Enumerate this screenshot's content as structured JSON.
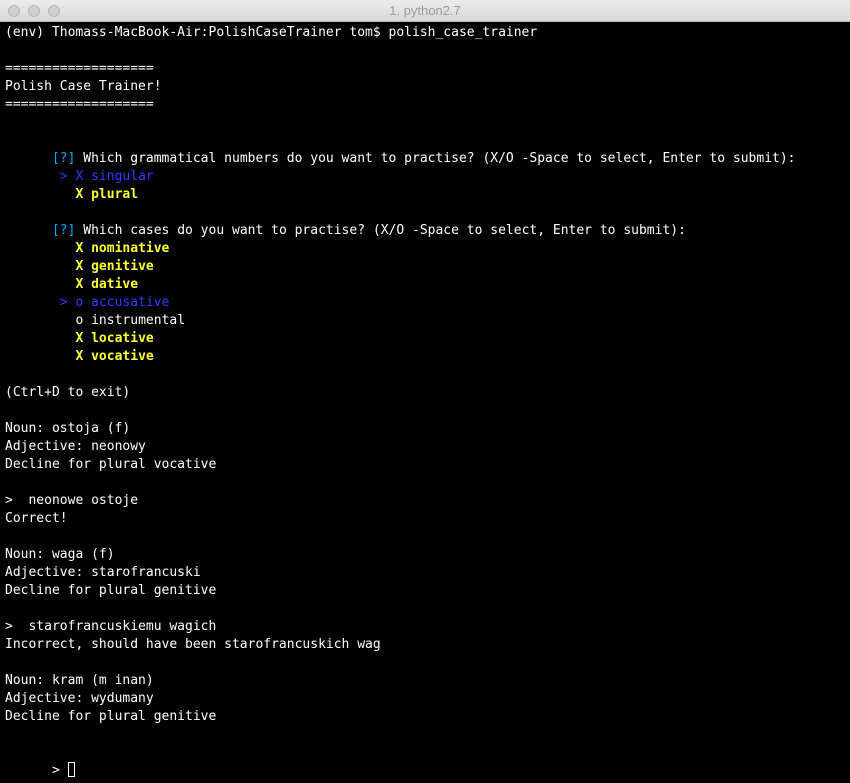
{
  "window": {
    "title": "1. python2.7"
  },
  "terminal": {
    "prompt_line": "(env) Thomass-MacBook-Air:PolishCaseTrainer tom$ polish_case_trainer",
    "banner_rule_top": "===================",
    "banner_title": "Polish Case Trainer!",
    "banner_rule_bottom": "===================",
    "q1": {
      "marker": "[?]",
      "text": " Which grammatical numbers do you want to practise? (X/O -Space to select, Enter to submit):",
      "options": [
        {
          "pointer": " > ",
          "check": "X",
          "label": "singular",
          "state": "cursor"
        },
        {
          "pointer": "   ",
          "check": "X",
          "label": "plural",
          "state": "selected"
        }
      ]
    },
    "q2": {
      "marker": "[?]",
      "text": " Which cases do you want to practise? (X/O -Space to select, Enter to submit):",
      "options": [
        {
          "pointer": "   ",
          "check": "X",
          "label": "nominative",
          "state": "selected"
        },
        {
          "pointer": "   ",
          "check": "X",
          "label": "genitive",
          "state": "selected"
        },
        {
          "pointer": "   ",
          "check": "X",
          "label": "dative",
          "state": "selected"
        },
        {
          "pointer": " > ",
          "check": "o",
          "label": "accusative",
          "state": "cursor"
        },
        {
          "pointer": "   ",
          "check": "o",
          "label": "instrumental",
          "state": "unselected"
        },
        {
          "pointer": "   ",
          "check": "X",
          "label": "locative",
          "state": "selected"
        },
        {
          "pointer": "   ",
          "check": "X",
          "label": "vocative",
          "state": "selected"
        }
      ]
    },
    "exit_hint": "(Ctrl+D to exit)",
    "exercises": [
      {
        "noun": "Noun: ostoja (f)",
        "adjective": "Adjective: neonowy",
        "task": "Decline for plural vocative",
        "answer": ">  neonowe ostoje",
        "feedback": "Correct!"
      },
      {
        "noun": "Noun: waga (f)",
        "adjective": "Adjective: starofrancuski",
        "task": "Decline for plural genitive",
        "answer": ">  starofrancuskiemu wagich",
        "feedback": "Incorrect, should have been starofrancuskich wag"
      },
      {
        "noun": "Noun: kram (m inan)",
        "adjective": "Adjective: wydumany",
        "task": "Decline for plural genitive"
      }
    ],
    "input_prompt": "> "
  },
  "colors": {
    "background": "#000000",
    "text": "#ffffff",
    "marker": "#00aaff",
    "cursor_option": "#2f3bff",
    "selected_option": "#ffff33"
  },
  "icons": {
    "close": "close-button-icon",
    "minimize": "minimize-button-icon",
    "maximize": "zoom-button-icon"
  }
}
